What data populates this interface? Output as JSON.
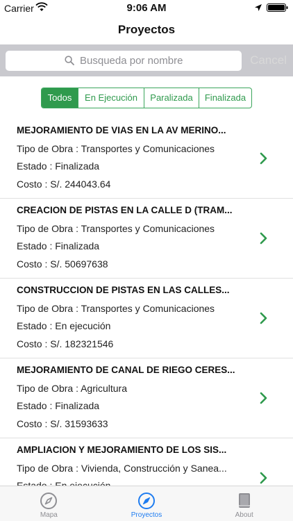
{
  "status_bar": {
    "carrier": "Carrier",
    "time": "9:06 AM"
  },
  "nav": {
    "title": "Proyectos"
  },
  "search": {
    "placeholder": "Busqueda por nombre",
    "cancel_label": "Cancel"
  },
  "filters": [
    {
      "label": "Todos",
      "active": true
    },
    {
      "label": "En Ejecución",
      "active": false
    },
    {
      "label": "Paralizada",
      "active": false
    },
    {
      "label": "Finalizada",
      "active": false
    }
  ],
  "projects": [
    {
      "title": "MEJORAMIENTO DE VIAS EN LA AV MERINO...",
      "tipo": "Tipo de Obra : Transportes y Comunicaciones",
      "estado": "Estado : Finalizada",
      "costo": "Costo : S/. 244043.64"
    },
    {
      "title": "CREACION DE PISTAS EN LA CALLE D (TRAM...",
      "tipo": "Tipo de Obra : Transportes y Comunicaciones",
      "estado": "Estado : Finalizada",
      "costo": "Costo : S/. 50697638"
    },
    {
      "title": "CONSTRUCCION DE PISTAS EN LAS CALLES...",
      "tipo": "Tipo de Obra : Transportes y Comunicaciones",
      "estado": "Estado : En ejecución",
      "costo": "Costo : S/. 182321546"
    },
    {
      "title": "MEJORAMIENTO DE CANAL DE RIEGO CERES...",
      "tipo": "Tipo de Obra : Agricultura",
      "estado": "Estado : Finalizada",
      "costo": "Costo : S/. 31593633"
    },
    {
      "title": "AMPLIACION Y MEJORAMIENTO DE LOS SIS...",
      "tipo": "Tipo de Obra : Vivienda, Construcción y Sanea...",
      "estado": "Estado : En ejecución",
      "costo": ""
    }
  ],
  "tabs": [
    {
      "label": "Mapa",
      "icon": "compass-icon",
      "active": false
    },
    {
      "label": "Proyectos",
      "icon": "compass-icon",
      "active": true
    },
    {
      "label": "About",
      "icon": "book-icon",
      "active": false
    }
  ],
  "colors": {
    "accent_green": "#2f9a4d",
    "tab_active_blue": "#1e7cf0",
    "chevron_green": "#2f9a4d"
  }
}
